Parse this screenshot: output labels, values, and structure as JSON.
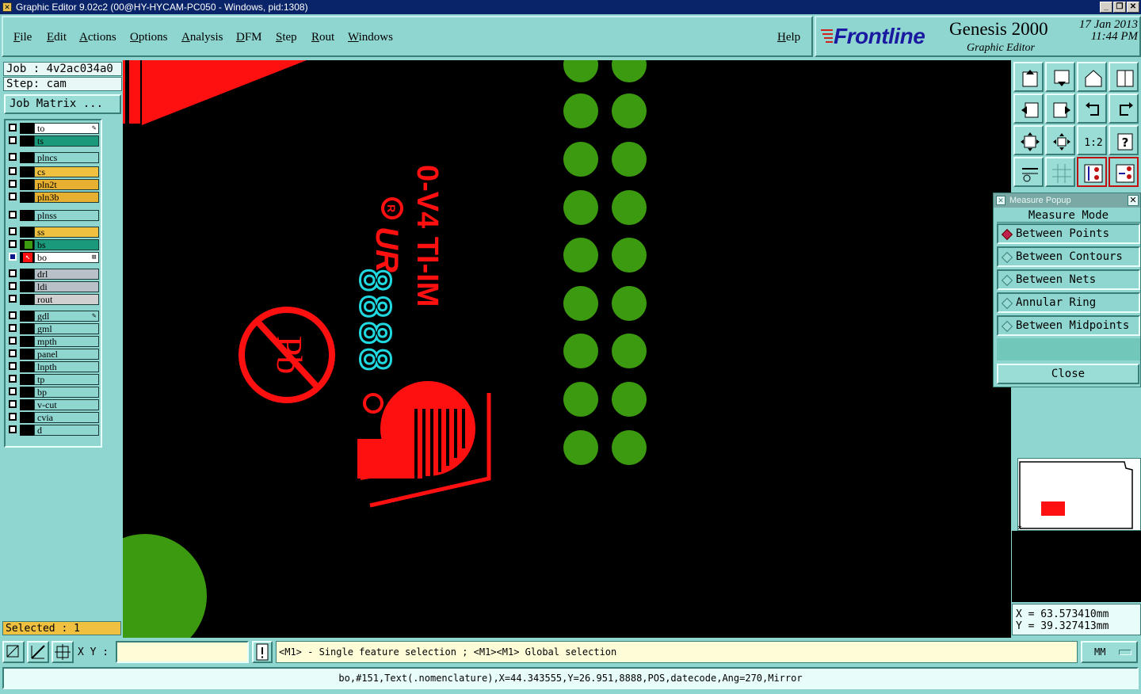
{
  "window": {
    "title": "Graphic Editor 9.02c2 (00@HY-HYCAM-PC050 - Windows, pid:1308)",
    "controls": [
      "_",
      "❐",
      "✕"
    ]
  },
  "menu": {
    "items": [
      "File",
      "Edit",
      "Actions",
      "Options",
      "Analysis",
      "DFM",
      "Step",
      "Rout",
      "Windows"
    ],
    "help": "Help"
  },
  "brand": {
    "logo": "Frontline",
    "product": "Genesis 2000",
    "subtitle": "Graphic Editor",
    "date": "17 Jan 2013",
    "time": "11:44 PM"
  },
  "job": {
    "job_line": "Job : 4v2ac034a0",
    "step_line": "Step: cam",
    "matrix_button": "Job Matrix ..."
  },
  "layers": [
    {
      "name": "to",
      "color": "#ffffff",
      "marker": "✎"
    },
    {
      "name": "ts",
      "color": "#1a9a7a"
    },
    {
      "name": "plncs",
      "color": "#8fd6d0"
    },
    {
      "name": "cs",
      "color": "#f0c040"
    },
    {
      "name": "pln2t",
      "color": "#e8b030"
    },
    {
      "name": "pln3b",
      "color": "#e8b030"
    },
    {
      "name": "plnss",
      "color": "#8fd6d0"
    },
    {
      "name": "ss",
      "color": "#f0c040"
    },
    {
      "name": "bs",
      "color": "#1a9a7a"
    },
    {
      "name": "bo",
      "color": "#ffffff",
      "marker": "⊞",
      "active": true
    },
    {
      "name": "drl",
      "color": "#b8c0c8"
    },
    {
      "name": "ldi",
      "color": "#b8c0c8"
    },
    {
      "name": "rout",
      "color": "#d0d0d0"
    },
    {
      "name": "gdl",
      "color": "#8fd6d0",
      "marker": "✎"
    },
    {
      "name": "gml",
      "color": "#8fd6d0"
    },
    {
      "name": "mpth",
      "color": "#8fd6d0"
    },
    {
      "name": "panel",
      "color": "#8fd6d0"
    },
    {
      "name": "lnpth",
      "color": "#8fd6d0"
    },
    {
      "name": "tp",
      "color": "#8fd6d0"
    },
    {
      "name": "bp",
      "color": "#8fd6d0"
    },
    {
      "name": "v-cut",
      "color": "#8fd6d0"
    },
    {
      "name": "cvia",
      "color": "#8fd6d0"
    },
    {
      "name": "d",
      "color": "#8fd6d0"
    }
  ],
  "selected_label": "Selected : 1",
  "canvas": {
    "marking_text": "0-V4 TI-IM",
    "date_code": "8888",
    "pad_color": "#3c9a10",
    "silk_color": "#ff1010",
    "cyan_color": "#20d8e0"
  },
  "toolbox_icons": [
    "zoom-home-icon",
    "pan-down-icon",
    "home-icon",
    "split-view-icon",
    "pan-left-icon",
    "pan-right-icon",
    "undo-view-icon",
    "redo-view-icon",
    "fit-icon",
    "center-icon",
    "scale-icon",
    "help-icon",
    "tools-icon",
    "grid-icon",
    "layers-a-icon",
    "layers-b-icon"
  ],
  "toolbox_labels": {
    "scale": "1:2",
    "help": "?"
  },
  "measure_popup": {
    "title": "Measure Popup",
    "heading": "Measure Mode",
    "options": [
      "Between Points",
      "Between Contours",
      "Between Nets",
      "Annular Ring",
      "Between Midpoints"
    ],
    "selected": 0,
    "close": "Close"
  },
  "coords": {
    "x": "X = 63.573410mm",
    "y": "Y = 39.327413mm"
  },
  "status": {
    "xy_label": "X Y :",
    "xy_value": "",
    "hint": "<M1> - Single feature selection ; <M1><M1> Global selection",
    "units": "MM",
    "info": "bo,#151,Text(.nomenclature),X=44.343555,Y=26.951,8888,POS,datecode,Ang=270,Mirror"
  }
}
